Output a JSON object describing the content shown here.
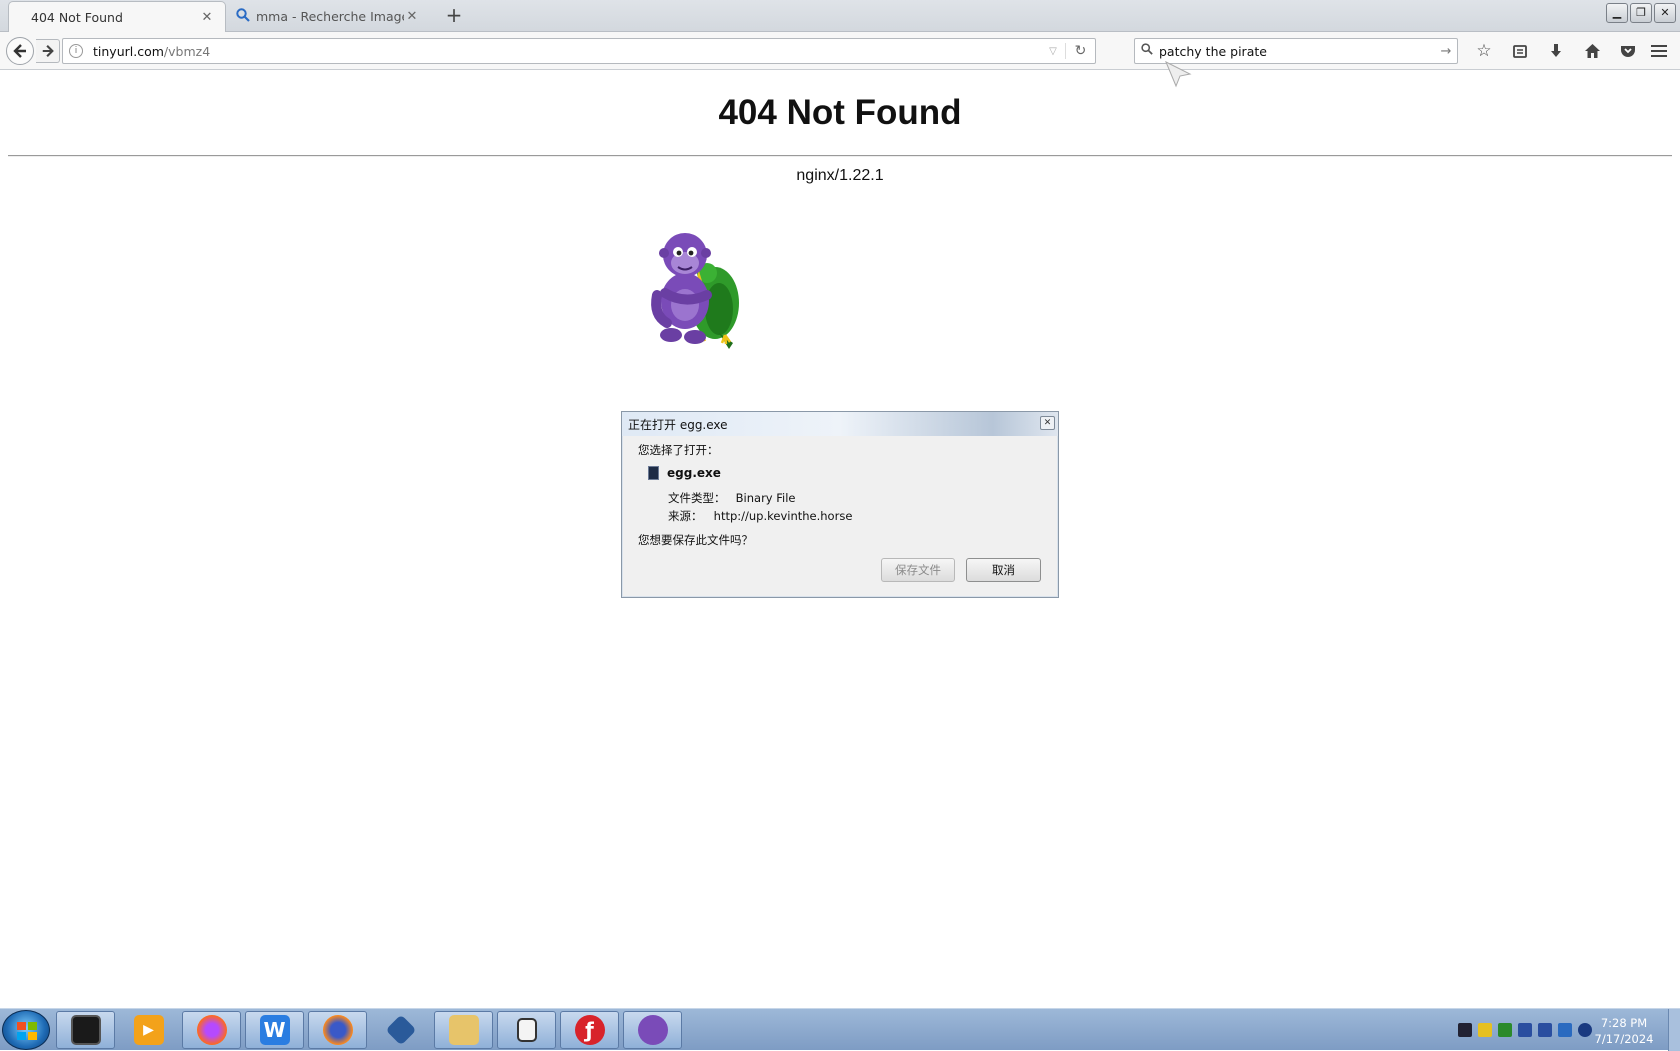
{
  "browser": {
    "tabs": [
      {
        "label": "404 Not Found",
        "active": true
      },
      {
        "label": "mma - Recherche Images",
        "active": false
      }
    ],
    "new_tab": "+",
    "url": {
      "host": "tinyurl.com",
      "path": "/vbmz4"
    },
    "search": {
      "value": "patchy the pirate"
    },
    "toolbar_icons": [
      "bookmark-star-icon",
      "reading-list-icon",
      "download-icon",
      "home-icon",
      "pocket-icon",
      "menu-icon"
    ]
  },
  "page": {
    "title": "404 Not Found",
    "server": "nginx/1.22.1",
    "mascot_icon": "purple-gorilla-with-parrot"
  },
  "dialog": {
    "title": "正在打开 egg.exe",
    "prompt": "您选择了打开：",
    "filename": "egg.exe",
    "type_label": "文件类型：",
    "type_value": "Binary File",
    "source_label": "来源：",
    "source_value": "http://up.kevinthe.horse",
    "question": "您想要保存此文件吗？",
    "save_label": "保存文件",
    "cancel_label": "取消"
  },
  "taskbar": {
    "apps": [
      "media-box-icon",
      "media-player-icon",
      "firefox-icon",
      "word-w-icon",
      "firefox-icon",
      "virtualbox-icon",
      "explorer-icon",
      "folder-icon",
      "flash-icon",
      "bonzi-icon"
    ],
    "time": "7:28 PM",
    "date": "7/17/2024"
  },
  "colors": {
    "titlebar_accent": "#b7c6d8",
    "taskbar": "#8fb0d8"
  }
}
